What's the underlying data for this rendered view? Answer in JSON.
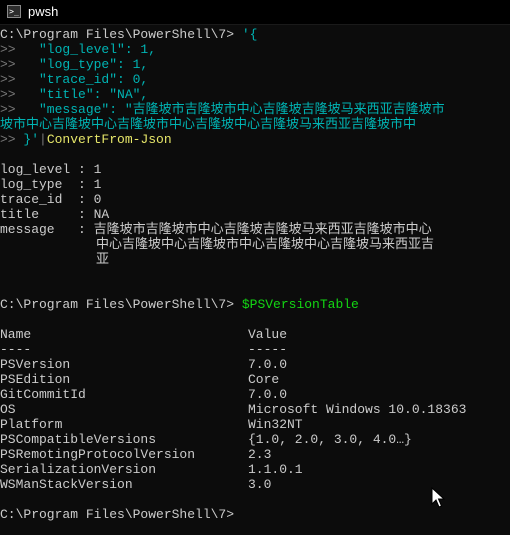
{
  "window": {
    "title": "pwsh",
    "icon": "powershell-icon"
  },
  "colors": {
    "background": "#0c0c0c",
    "text": "#cccccc",
    "string": "#00b4b4",
    "command": "#e6e669",
    "variable": "#13d613",
    "continuation": "#787878"
  },
  "console": {
    "prompt1": {
      "path": "C:\\Program Files\\PowerShell\\7> ",
      "arg": "'{"
    },
    "continuation_lines": [
      {
        "prefix": ">> ",
        "text": "  \"log_level\": 1,"
      },
      {
        "prefix": ">> ",
        "text": "  \"log_type\": 1,"
      },
      {
        "prefix": ">> ",
        "text": "  \"trace_id\": 0,"
      },
      {
        "prefix": ">> ",
        "text": "  \"title\": \"NA\","
      },
      {
        "prefix": ">> ",
        "text": "  \"message\": \"吉隆坡市吉隆坡市中心吉隆坡吉隆坡马来西亚吉隆坡市"
      }
    ],
    "wrap_line": "坡市中心吉隆坡中心吉隆坡市中心吉隆坡中心吉隆坡马来西亚吉隆坡市中",
    "last_line": {
      "prefix": ">> ",
      "string": "}'",
      "pipe": "|",
      "command": "ConvertFrom-Json"
    },
    "json_output": [
      {
        "key": "log_level : ",
        "value": "1"
      },
      {
        "key": "log_type  : ",
        "value": "1"
      },
      {
        "key": "trace_id  : ",
        "value": "0"
      },
      {
        "key": "title     : ",
        "value": "NA"
      },
      {
        "key": "message   : ",
        "value": "吉隆坡市吉隆坡市中心吉隆坡吉隆坡马来西亚吉隆坡市中心"
      }
    ],
    "message_wrap": [
      "中心吉隆坡中心吉隆坡市中心吉隆坡中心吉隆坡马来西亚吉",
      "亚"
    ],
    "prompt2": {
      "path": "C:\\Program Files\\PowerShell\\7> ",
      "variable": "$PSVersionTable"
    },
    "table": {
      "header_name": "Name",
      "header_value": "Value",
      "sep_name": "----",
      "sep_value": "-----",
      "rows": [
        {
          "name": "PSVersion",
          "value": "7.0.0"
        },
        {
          "name": "PSEdition",
          "value": "Core"
        },
        {
          "name": "GitCommitId",
          "value": "7.0.0"
        },
        {
          "name": "OS",
          "value": "Microsoft Windows 10.0.18363"
        },
        {
          "name": "Platform",
          "value": "Win32NT"
        },
        {
          "name": "PSCompatibleVersions",
          "value": "{1.0, 2.0, 3.0, 4.0…}"
        },
        {
          "name": "PSRemotingProtocolVersion",
          "value": "2.3"
        },
        {
          "name": "SerializationVersion",
          "value": "1.1.0.1"
        },
        {
          "name": "WSManStackVersion",
          "value": "3.0"
        }
      ]
    },
    "prompt3": "C:\\Program Files\\PowerShell\\7>"
  }
}
